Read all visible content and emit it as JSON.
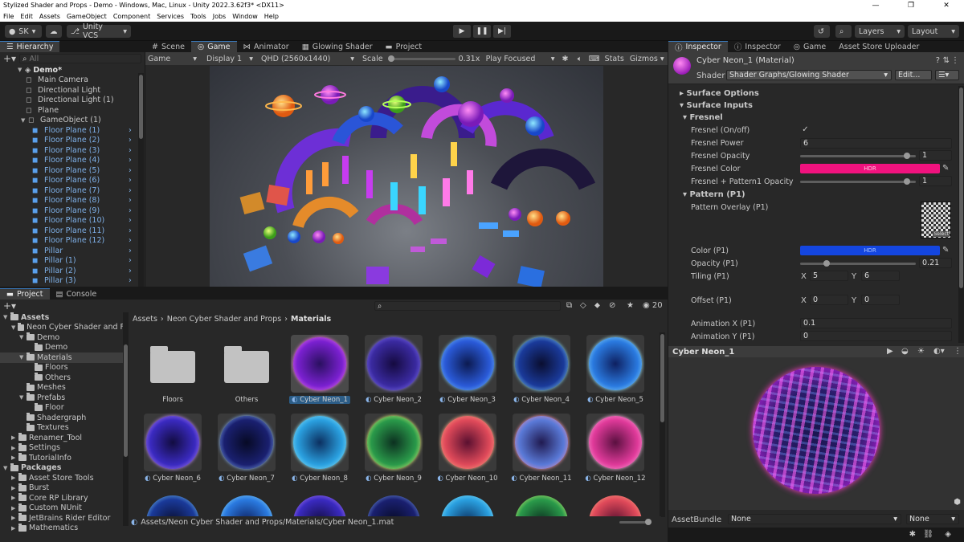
{
  "window": {
    "title": "Stylized Shader and Props - Demo - Windows, Mac, Linux - Unity 2022.3.62f3* <DX11>",
    "controls": [
      "—",
      "❐",
      "✕"
    ]
  },
  "menu": [
    "File",
    "Edit",
    "Assets",
    "GameObject",
    "Component",
    "Services",
    "Tools",
    "Jobs",
    "Window",
    "Help"
  ],
  "toolbar": {
    "account": "SK",
    "vcs": "Unity VCS",
    "layers": "Layers",
    "layout": "Layout"
  },
  "hierarchy": {
    "tab": "Hierarchy",
    "search_placeholder": "All",
    "scene": "Demo*",
    "items": [
      {
        "label": "Main Camera",
        "blue": false
      },
      {
        "label": "Directional Light",
        "blue": false
      },
      {
        "label": "Directional Light (1)",
        "blue": false
      },
      {
        "label": "Plane",
        "blue": false
      },
      {
        "label": "GameObject (1)",
        "blue": false
      },
      {
        "label": "Floor Plane (1)",
        "blue": true
      },
      {
        "label": "Floor Plane (2)",
        "blue": true
      },
      {
        "label": "Floor Plane (3)",
        "blue": true
      },
      {
        "label": "Floor Plane (4)",
        "blue": true
      },
      {
        "label": "Floor Plane (5)",
        "blue": true
      },
      {
        "label": "Floor Plane (6)",
        "blue": true
      },
      {
        "label": "Floor Plane (7)",
        "blue": true
      },
      {
        "label": "Floor Plane (8)",
        "blue": true
      },
      {
        "label": "Floor Plane (9)",
        "blue": true
      },
      {
        "label": "Floor Plane (10)",
        "blue": true
      },
      {
        "label": "Floor Plane (11)",
        "blue": true
      },
      {
        "label": "Floor Plane (12)",
        "blue": true
      },
      {
        "label": "Pillar",
        "blue": true
      },
      {
        "label": "Pillar (1)",
        "blue": true
      },
      {
        "label": "Pillar (2)",
        "blue": true
      },
      {
        "label": "Pillar (3)",
        "blue": true
      }
    ]
  },
  "center_tabs": [
    "Scene",
    "Game",
    "Animator",
    "Glowing Shader",
    "Project"
  ],
  "game_bar": {
    "mode": "Game",
    "display": "Display 1",
    "resolution": "QHD (2560x1440)",
    "scale_label": "Scale",
    "scale_value": "0.31x",
    "play_focused": "Play Focused",
    "stats": "Stats",
    "gizmos": "Gizmos"
  },
  "project": {
    "tabs": [
      "Project",
      "Console"
    ],
    "count": "20",
    "breadcrumb": [
      "Assets",
      "Neon Cyber Shader and Props",
      "Materials"
    ],
    "tree": [
      {
        "label": "Assets",
        "indent": 0,
        "bold": true
      },
      {
        "label": "Neon Cyber Shader and F",
        "indent": 1,
        "bold": false
      },
      {
        "label": "Demo",
        "indent": 2,
        "bold": false
      },
      {
        "label": "Demo",
        "indent": 3,
        "bold": false
      },
      {
        "label": "Materials",
        "indent": 2,
        "bold": false
      },
      {
        "label": "Floors",
        "indent": 3,
        "bold": false
      },
      {
        "label": "Others",
        "indent": 3,
        "bold": false
      },
      {
        "label": "Meshes",
        "indent": 2,
        "bold": false
      },
      {
        "label": "Prefabs",
        "indent": 2,
        "bold": false
      },
      {
        "label": "Floor",
        "indent": 3,
        "bold": false
      },
      {
        "label": "Shadergraph",
        "indent": 2,
        "bold": false
      },
      {
        "label": "Textures",
        "indent": 2,
        "bold": false
      },
      {
        "label": "Renamer_Tool",
        "indent": 1,
        "bold": false
      },
      {
        "label": "Settings",
        "indent": 1,
        "bold": false
      },
      {
        "label": "TutorialInfo",
        "indent": 1,
        "bold": false
      },
      {
        "label": "Packages",
        "indent": 0,
        "bold": true
      },
      {
        "label": "Asset Store Tools",
        "indent": 1,
        "bold": false
      },
      {
        "label": "Burst",
        "indent": 1,
        "bold": false
      },
      {
        "label": "Core RP Library",
        "indent": 1,
        "bold": false
      },
      {
        "label": "Custom NUnit",
        "indent": 1,
        "bold": false
      },
      {
        "label": "JetBrains Rider Editor",
        "indent": 1,
        "bold": false
      },
      {
        "label": "Mathematics",
        "indent": 1,
        "bold": false
      }
    ],
    "assets_row1": [
      "Floors",
      "Others",
      "Cyber Neon_1",
      "Cyber Neon_2",
      "Cyber Neon_3",
      "Cyber Neon_4",
      "Cyber Neon_5"
    ],
    "assets_row2": [
      "Cyber Neon_6",
      "Cyber Neon_7",
      "Cyber Neon_8",
      "Cyber Neon_9",
      "Cyber Neon_10",
      "Cyber Neon_11",
      "Cyber Neon_12"
    ],
    "status_path": "Assets/Neon Cyber Shader and Props/Materials/Cyber Neon_1.mat"
  },
  "inspector": {
    "tabs": [
      "Inspector",
      "Inspector",
      "Game",
      "Asset Store Uploader"
    ],
    "material_name": "Cyber Neon_1 (Material)",
    "shader_label": "Shader",
    "shader_value": "Shader Graphs/Glowing Shader",
    "edit": "Edit...",
    "surface_options": "Surface Options",
    "surface_inputs": "Surface Inputs",
    "fresnel": "Fresnel",
    "fresnel_onoff": "Fresnel (On/off)",
    "fresnel_power": "Fresnel Power",
    "fresnel_power_val": "6",
    "fresnel_opacity": "Fresnel Opacity",
    "fresnel_opacity_val": "1",
    "fresnel_color": "Fresnel Color",
    "hdr": "HDR",
    "fresnel_pattern_opacity": "Fresnel + Pattern1 Opacity",
    "fresnel_pattern_opacity_val": "1",
    "pattern": "Pattern (P1)",
    "pattern_overlay": "Pattern Overlay (P1)",
    "select": "Select",
    "color_p1": "Color (P1)",
    "opacity_p1": "Opacity (P1)",
    "opacity_p1_val": "0.21",
    "tiling_p1": "Tiling (P1)",
    "tiling_x": "5",
    "tiling_y": "6",
    "offset_p1": "Offset (P1)",
    "offset_x": "0",
    "offset_y": "0",
    "x": "X",
    "y": "Y",
    "anim_x": "Animation X (P1)",
    "anim_x_val": "0.1",
    "anim_y": "Animation Y (P1)",
    "anim_y_val": "0",
    "preview_title": "Cyber Neon_1",
    "assetbundle_label": "AssetBundle",
    "assetbundle_val": "None",
    "assetbundle_variant": "None",
    "fresnel_pattern_ratio": 0.95,
    "fresnel_opacity_ratio": 0.95,
    "opacity_p1_ratio": 0.21,
    "colors": {
      "fresnel": "#f0127e",
      "color_p1": "#1446e0",
      "accent": "#3a79bb"
    }
  }
}
